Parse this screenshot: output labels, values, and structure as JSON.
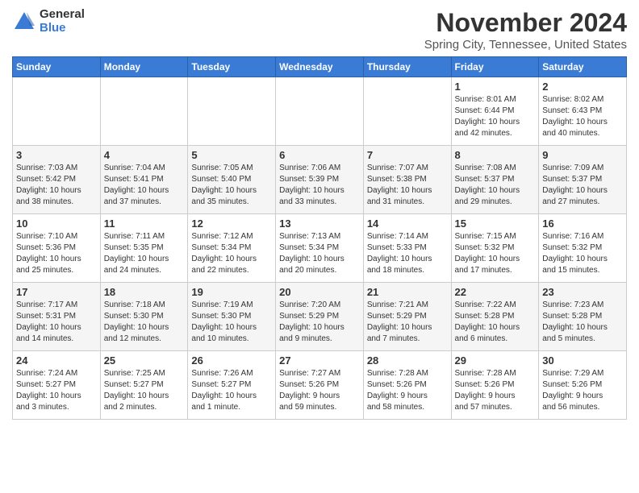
{
  "logo": {
    "general": "General",
    "blue": "Blue"
  },
  "title": "November 2024",
  "location": "Spring City, Tennessee, United States",
  "days_of_week": [
    "Sunday",
    "Monday",
    "Tuesday",
    "Wednesday",
    "Thursday",
    "Friday",
    "Saturday"
  ],
  "weeks": [
    [
      {
        "day": "",
        "info": ""
      },
      {
        "day": "",
        "info": ""
      },
      {
        "day": "",
        "info": ""
      },
      {
        "day": "",
        "info": ""
      },
      {
        "day": "",
        "info": ""
      },
      {
        "day": "1",
        "info": "Sunrise: 8:01 AM\nSunset: 6:44 PM\nDaylight: 10 hours\nand 42 minutes."
      },
      {
        "day": "2",
        "info": "Sunrise: 8:02 AM\nSunset: 6:43 PM\nDaylight: 10 hours\nand 40 minutes."
      }
    ],
    [
      {
        "day": "3",
        "info": "Sunrise: 7:03 AM\nSunset: 5:42 PM\nDaylight: 10 hours\nand 38 minutes."
      },
      {
        "day": "4",
        "info": "Sunrise: 7:04 AM\nSunset: 5:41 PM\nDaylight: 10 hours\nand 37 minutes."
      },
      {
        "day": "5",
        "info": "Sunrise: 7:05 AM\nSunset: 5:40 PM\nDaylight: 10 hours\nand 35 minutes."
      },
      {
        "day": "6",
        "info": "Sunrise: 7:06 AM\nSunset: 5:39 PM\nDaylight: 10 hours\nand 33 minutes."
      },
      {
        "day": "7",
        "info": "Sunrise: 7:07 AM\nSunset: 5:38 PM\nDaylight: 10 hours\nand 31 minutes."
      },
      {
        "day": "8",
        "info": "Sunrise: 7:08 AM\nSunset: 5:37 PM\nDaylight: 10 hours\nand 29 minutes."
      },
      {
        "day": "9",
        "info": "Sunrise: 7:09 AM\nSunset: 5:37 PM\nDaylight: 10 hours\nand 27 minutes."
      }
    ],
    [
      {
        "day": "10",
        "info": "Sunrise: 7:10 AM\nSunset: 5:36 PM\nDaylight: 10 hours\nand 25 minutes."
      },
      {
        "day": "11",
        "info": "Sunrise: 7:11 AM\nSunset: 5:35 PM\nDaylight: 10 hours\nand 24 minutes."
      },
      {
        "day": "12",
        "info": "Sunrise: 7:12 AM\nSunset: 5:34 PM\nDaylight: 10 hours\nand 22 minutes."
      },
      {
        "day": "13",
        "info": "Sunrise: 7:13 AM\nSunset: 5:34 PM\nDaylight: 10 hours\nand 20 minutes."
      },
      {
        "day": "14",
        "info": "Sunrise: 7:14 AM\nSunset: 5:33 PM\nDaylight: 10 hours\nand 18 minutes."
      },
      {
        "day": "15",
        "info": "Sunrise: 7:15 AM\nSunset: 5:32 PM\nDaylight: 10 hours\nand 17 minutes."
      },
      {
        "day": "16",
        "info": "Sunrise: 7:16 AM\nSunset: 5:32 PM\nDaylight: 10 hours\nand 15 minutes."
      }
    ],
    [
      {
        "day": "17",
        "info": "Sunrise: 7:17 AM\nSunset: 5:31 PM\nDaylight: 10 hours\nand 14 minutes."
      },
      {
        "day": "18",
        "info": "Sunrise: 7:18 AM\nSunset: 5:30 PM\nDaylight: 10 hours\nand 12 minutes."
      },
      {
        "day": "19",
        "info": "Sunrise: 7:19 AM\nSunset: 5:30 PM\nDaylight: 10 hours\nand 10 minutes."
      },
      {
        "day": "20",
        "info": "Sunrise: 7:20 AM\nSunset: 5:29 PM\nDaylight: 10 hours\nand 9 minutes."
      },
      {
        "day": "21",
        "info": "Sunrise: 7:21 AM\nSunset: 5:29 PM\nDaylight: 10 hours\nand 7 minutes."
      },
      {
        "day": "22",
        "info": "Sunrise: 7:22 AM\nSunset: 5:28 PM\nDaylight: 10 hours\nand 6 minutes."
      },
      {
        "day": "23",
        "info": "Sunrise: 7:23 AM\nSunset: 5:28 PM\nDaylight: 10 hours\nand 5 minutes."
      }
    ],
    [
      {
        "day": "24",
        "info": "Sunrise: 7:24 AM\nSunset: 5:27 PM\nDaylight: 10 hours\nand 3 minutes."
      },
      {
        "day": "25",
        "info": "Sunrise: 7:25 AM\nSunset: 5:27 PM\nDaylight: 10 hours\nand 2 minutes."
      },
      {
        "day": "26",
        "info": "Sunrise: 7:26 AM\nSunset: 5:27 PM\nDaylight: 10 hours\nand 1 minute."
      },
      {
        "day": "27",
        "info": "Sunrise: 7:27 AM\nSunset: 5:26 PM\nDaylight: 9 hours\nand 59 minutes."
      },
      {
        "day": "28",
        "info": "Sunrise: 7:28 AM\nSunset: 5:26 PM\nDaylight: 9 hours\nand 58 minutes."
      },
      {
        "day": "29",
        "info": "Sunrise: 7:28 AM\nSunset: 5:26 PM\nDaylight: 9 hours\nand 57 minutes."
      },
      {
        "day": "30",
        "info": "Sunrise: 7:29 AM\nSunset: 5:26 PM\nDaylight: 9 hours\nand 56 minutes."
      }
    ]
  ]
}
